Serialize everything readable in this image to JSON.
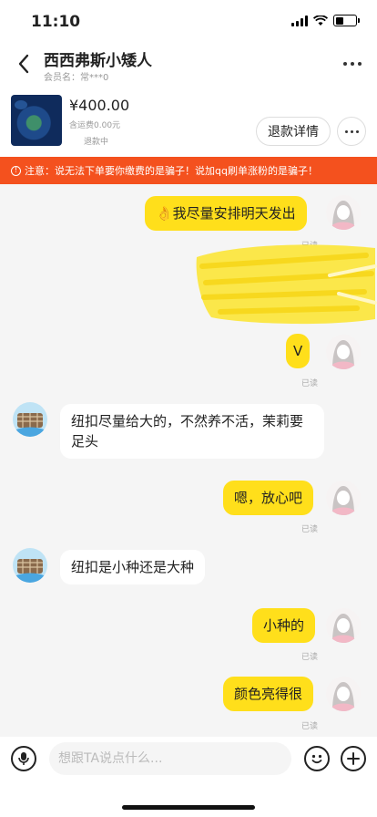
{
  "status_bar": {
    "time": "11:10"
  },
  "header": {
    "title": "西西弗斯小矮人",
    "member_label": "会员名：常***0"
  },
  "product": {
    "price": "¥400.00",
    "shipping": "含运费0.00元",
    "status": "退款中",
    "refund_button": "退款详情"
  },
  "warning": {
    "text": "注意：说无法下单要你缴费的是骗子！说加qq刷单涨粉的是骗子！"
  },
  "messages": [
    {
      "side": "me",
      "text": "👌我尽量安排明天发出",
      "read": "已读"
    },
    {
      "side": "me",
      "text": "",
      "read": "",
      "type": "redacted-image"
    },
    {
      "side": "me",
      "text": "V",
      "read": "已读"
    },
    {
      "side": "other",
      "text": "纽扣尽量给大的，不然养不活，茉莉要足头",
      "read": ""
    },
    {
      "side": "me",
      "text": "嗯，放心吧",
      "read": "已读"
    },
    {
      "side": "other",
      "text": "纽扣是小种还是大种",
      "read": ""
    },
    {
      "side": "me",
      "text": "小种的",
      "read": "已读"
    },
    {
      "side": "me",
      "text": "颜色亮得很",
      "read": "已读"
    }
  ],
  "input": {
    "placeholder": "想跟TA说点什么..."
  },
  "icons": {
    "back": "chevron-left-icon",
    "more": "more-dots-icon",
    "warning": "info-circle-icon",
    "mic": "microphone-icon",
    "emoji": "emoji-icon",
    "plus": "plus-icon"
  },
  "colors": {
    "bubble_me": "#ffdf1b",
    "warning_bg": "#f4511e",
    "background": "#f5f5f5"
  }
}
